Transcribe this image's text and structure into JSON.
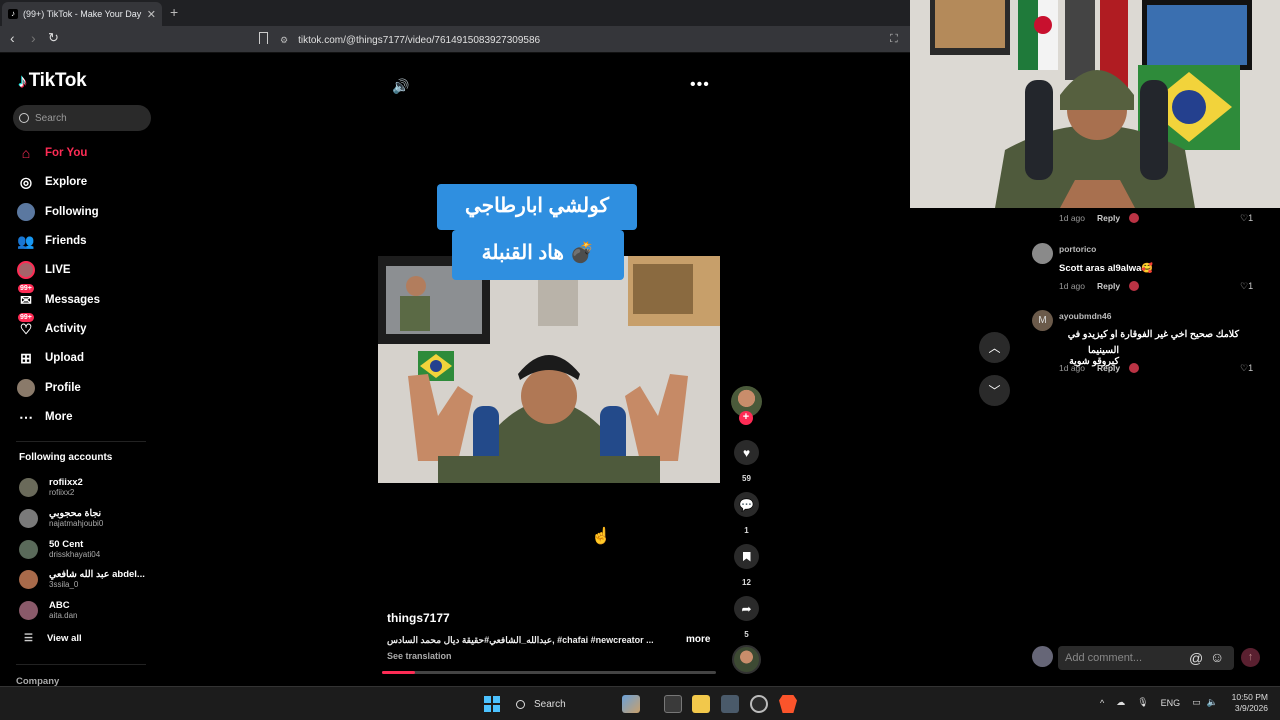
{
  "browser": {
    "tab_title": "(99+) TikTok - Make Your Day",
    "url": "tiktok.com/@things7177/video/7614915083927309586"
  },
  "sidebar": {
    "logo": "TikTok",
    "search_placeholder": "Search",
    "nav": [
      {
        "label": "For You",
        "icon": "home-icon",
        "active": true
      },
      {
        "label": "Explore",
        "icon": "compass-icon"
      },
      {
        "label": "Following",
        "icon": "following-avatar-icon"
      },
      {
        "label": "Friends",
        "icon": "friends-icon"
      },
      {
        "label": "LIVE",
        "icon": "live-icon"
      },
      {
        "label": "Messages",
        "icon": "messages-icon",
        "badge": "99+"
      },
      {
        "label": "Activity",
        "icon": "activity-icon",
        "badge": "99+"
      },
      {
        "label": "Upload",
        "icon": "upload-icon"
      },
      {
        "label": "Profile",
        "icon": "profile-avatar-icon"
      },
      {
        "label": "More",
        "icon": "more-dots-icon"
      }
    ],
    "following_title": "Following accounts",
    "accounts": [
      {
        "name": "rofiixx2",
        "handle": "rofiixx2"
      },
      {
        "name": "نجاة محجوبي",
        "handle": "najatmahjoubi0"
      },
      {
        "name": "50 Cent",
        "handle": "drisskhayati04"
      },
      {
        "name": "عبد الله شافعي abdel...",
        "handle": "3ssila_0"
      },
      {
        "name": "ABC",
        "handle": "aita.dan"
      }
    ],
    "view_all": "View all",
    "company": "Company"
  },
  "video": {
    "caption_line1": "كولشي ابارطاجي",
    "caption_line2": "هاد القنبلة 💣",
    "author": "things7177",
    "description": "عبدالله_الشافعي#حقيقة ديال محمد السادس, #chafai #newcreator ...",
    "more_label": "more",
    "see_translation": "See translation",
    "progress": 0.1
  },
  "actions": {
    "likes": "59",
    "comments": "1",
    "saves": "12",
    "shares": "5"
  },
  "comments": [
    {
      "user": "",
      "text": "",
      "meta_time": "1d ago",
      "reply": "Reply",
      "likes": "1"
    },
    {
      "user": "portorico",
      "text": "Scott aras al9alwa🥰",
      "meta_time": "1d ago",
      "reply": "Reply",
      "likes": "1"
    },
    {
      "user": "ayoubmdn46",
      "text": "كلامك صحيح اخي غير الفوقارة او كيزيدو في",
      "text2": "السينيما كيروقو شوية",
      "meta_time": "1d ago",
      "reply": "Reply",
      "likes": "1",
      "initial": "M"
    }
  ],
  "add_comment_placeholder": "Add comment...",
  "taskbar": {
    "search": "Search",
    "lang": "ENG",
    "time": "10:50 PM",
    "date": "3/9/2026"
  },
  "colors": {
    "accent": "#fe2c55",
    "caption_bg": "#2f8fe0"
  }
}
